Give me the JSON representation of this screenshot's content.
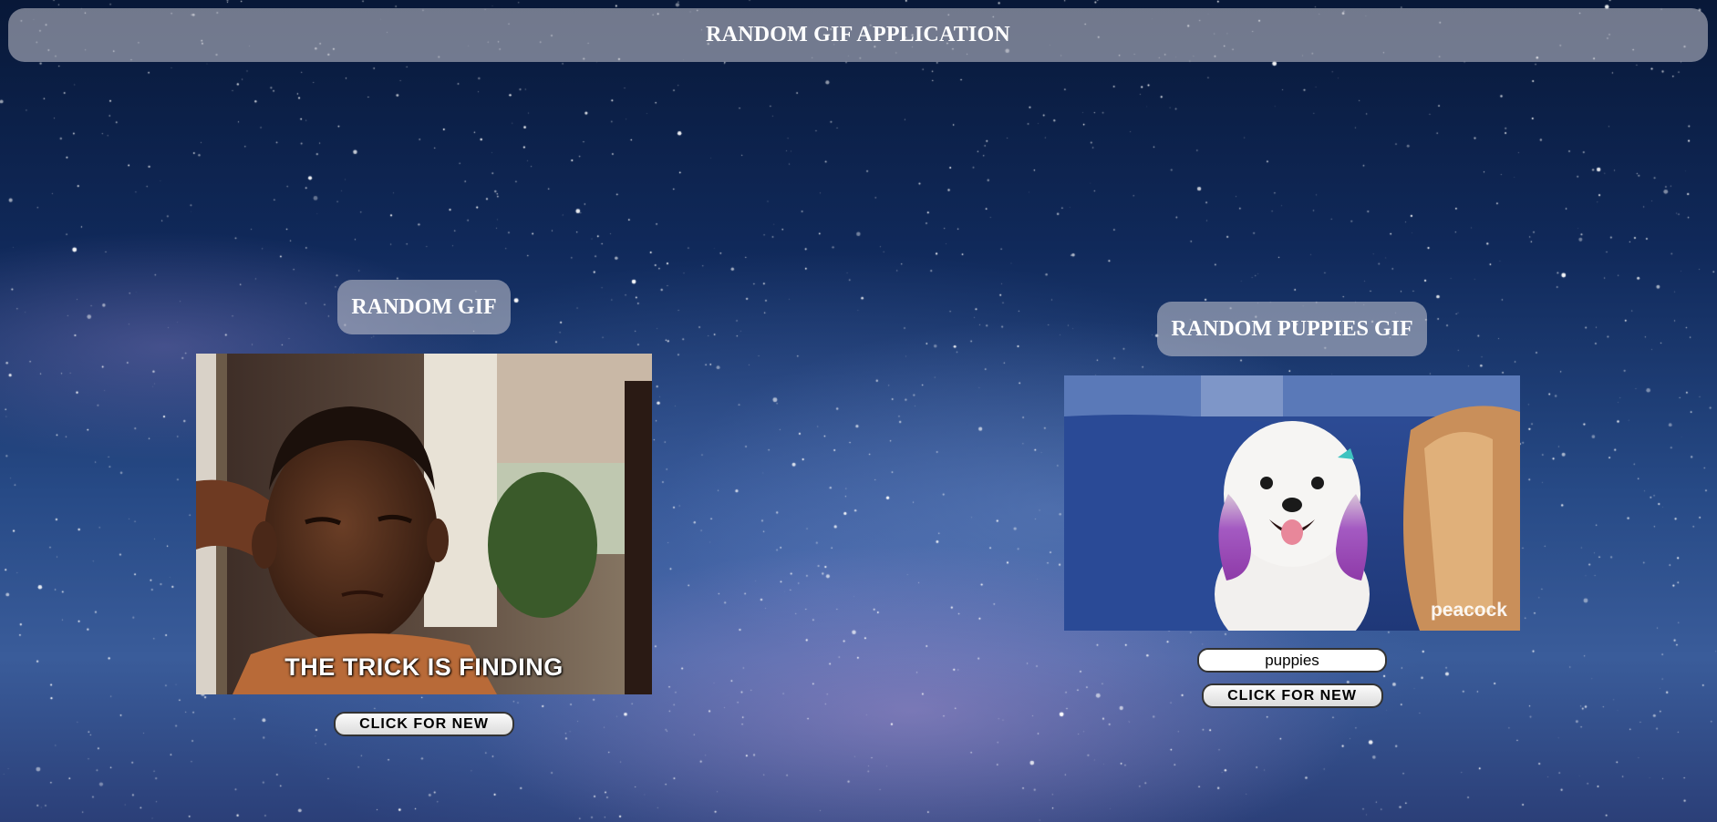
{
  "header": {
    "title": "RANDOM GIF APPLICATION"
  },
  "random_gif": {
    "title": "RANDOM GIF",
    "caption": "THE TRICK IS FINDING",
    "button_label": "CLICK FOR NEW"
  },
  "puppies_gif": {
    "title": "RANDOM PUPPIES GIF",
    "search_value": "puppies",
    "watermark": "peacock",
    "button_label": "CLICK FOR NEW"
  },
  "colors": {
    "panel_overlay": "#c8c8d2",
    "background_dark": "#081838",
    "background_mid": "#274a86",
    "button_face": "#f0f0f0",
    "button_border": "#333333"
  }
}
